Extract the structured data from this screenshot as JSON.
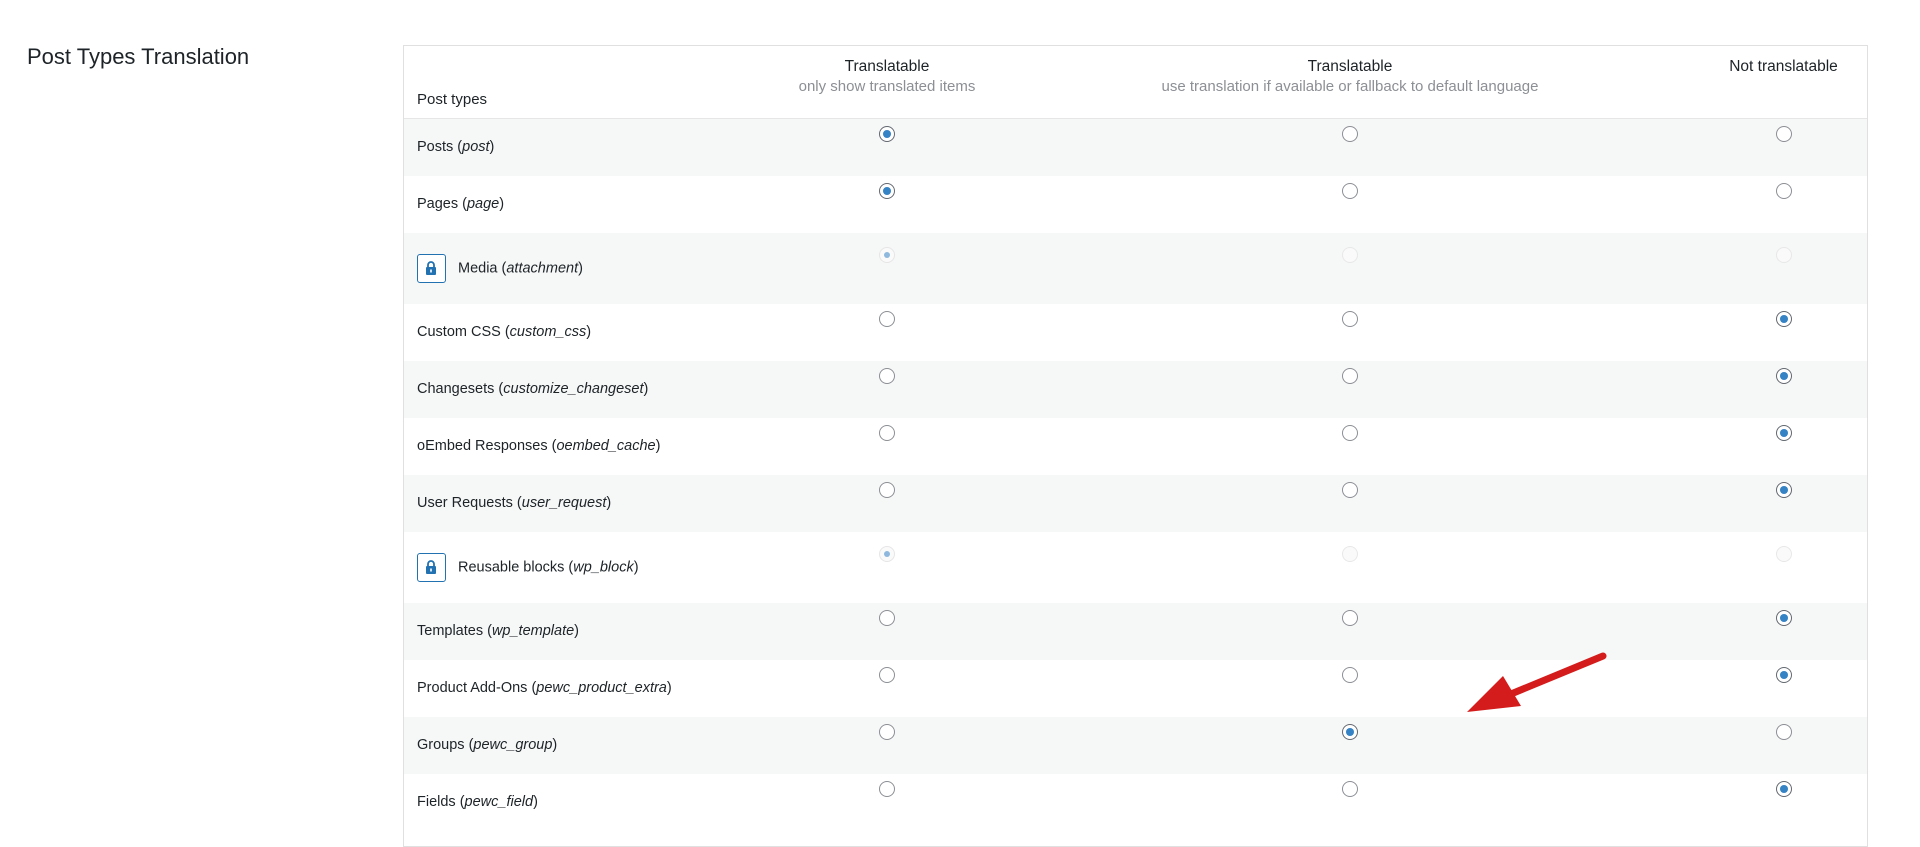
{
  "section": {
    "title": "Post Types Translation"
  },
  "table": {
    "header": {
      "post_types": "Post types",
      "col1_title": "Translatable",
      "col1_sub": "only show translated items",
      "col2_title": "Translatable",
      "col2_sub": "use translation if available or fallback to default language",
      "col3_title": "Not translatable"
    },
    "rows": [
      {
        "label": "Posts",
        "slug": "post",
        "locked": false,
        "selected": 1
      },
      {
        "label": "Pages",
        "slug": "page",
        "locked": false,
        "selected": 1
      },
      {
        "label": "Media",
        "slug": "attachment",
        "locked": true,
        "selected": 1
      },
      {
        "label": "Custom CSS",
        "slug": "custom_css",
        "locked": false,
        "selected": 3
      },
      {
        "label": "Changesets",
        "slug": "customize_changeset",
        "locked": false,
        "selected": 3
      },
      {
        "label": "oEmbed Responses",
        "slug": "oembed_cache",
        "locked": false,
        "selected": 3
      },
      {
        "label": "User Requests",
        "slug": "user_request",
        "locked": false,
        "selected": 3
      },
      {
        "label": "Reusable blocks",
        "slug": "wp_block",
        "locked": true,
        "selected": 1
      },
      {
        "label": "Templates",
        "slug": "wp_template",
        "locked": false,
        "selected": 3
      },
      {
        "label": "Product Add-Ons",
        "slug": "pewc_product_extra",
        "locked": false,
        "selected": 3
      },
      {
        "label": "Groups",
        "slug": "pewc_group",
        "locked": false,
        "selected": 2
      },
      {
        "label": "Fields",
        "slug": "pewc_field",
        "locked": false,
        "selected": 3
      }
    ]
  },
  "icons": {
    "lock": "lock-icon",
    "annotation": "red-arrow-annotation"
  },
  "colors": {
    "accent": "#3582c4",
    "lock_border": "#2271b1",
    "arrow": "#d41c1c"
  }
}
